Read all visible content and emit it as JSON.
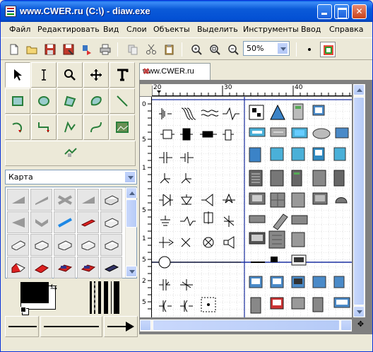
{
  "window": {
    "title": "www.CWER.ru (C:\\) - diaw.exe"
  },
  "menu": [
    "Файл",
    "Редактировать",
    "Вид",
    "Слои",
    "Объекты",
    "Выделить",
    "Инструменты",
    "Ввод",
    "Справка"
  ],
  "toolbar": {
    "zoom": "50%"
  },
  "tab": {
    "label": "www.CWER.ru",
    "close": "✖"
  },
  "sheets_dropdown": {
    "value": "Карта"
  },
  "ruler": {
    "top_labels": [
      "20",
      "30",
      "40"
    ],
    "left_labels": [
      "0",
      "5",
      "1",
      "5",
      "1",
      "5",
      "2",
      "5",
      "2"
    ]
  },
  "colors": {
    "foreground": "#000000",
    "background": "#ffffff",
    "accent": "#0831d9"
  }
}
